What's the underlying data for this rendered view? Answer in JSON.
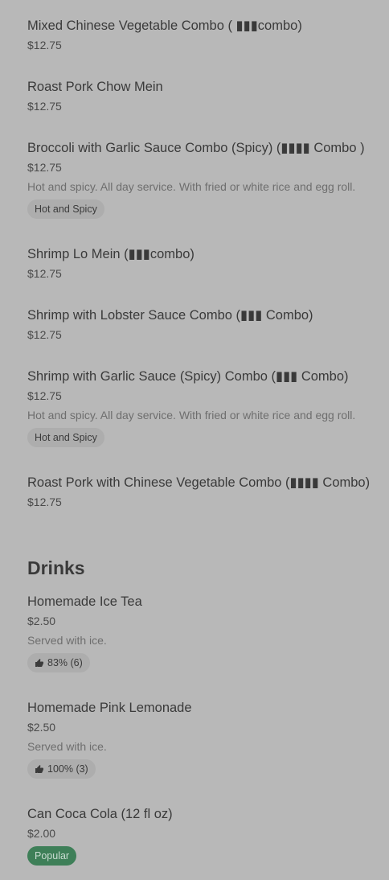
{
  "combos": [
    {
      "name": "Mixed Chinese Vegetable Combo ( ▮▮▮combo)",
      "price": "$12.75"
    },
    {
      "name": "Roast Pork Chow Mein",
      "price": "$12.75"
    },
    {
      "name": "Broccoli with Garlic Sauce Combo (Spicy) (▮▮▮▮ Combo )",
      "price": "$12.75",
      "description": "Hot and spicy. All day service. With fried or white rice and egg roll.",
      "tag": "Hot and Spicy"
    },
    {
      "name": "Shrimp Lo Mein (▮▮▮combo)",
      "price": "$12.75"
    },
    {
      "name": "Shrimp with Lobster Sauce Combo (▮▮▮ Combo)",
      "price": "$12.75"
    },
    {
      "name": "Shrimp with Garlic Sauce (Spicy) Combo (▮▮▮ Combo)",
      "price": "$12.75",
      "description": "Hot and spicy. All day service. With fried or white rice and egg roll.",
      "tag": "Hot and Spicy"
    },
    {
      "name": "Roast Pork with Chinese Vegetable Combo (▮▮▮▮ Combo)",
      "price": "$12.75"
    }
  ],
  "drinks_section": {
    "title": "Drinks",
    "items": [
      {
        "name": "Homemade Ice Tea",
        "price": "$2.50",
        "description": "Served with ice.",
        "rating": "83% (6)",
        "rating_icon": "thumbs-up-icon"
      },
      {
        "name": "Homemade Pink Lemonade",
        "price": "$2.50",
        "description": "Served with ice.",
        "rating": "100% (3)",
        "rating_icon": "thumbs-up-icon"
      },
      {
        "name": "Can Coca Cola (12 fl oz)",
        "price": "$2.00",
        "badge": "Popular",
        "badge_color": "#3e7f58"
      }
    ]
  }
}
